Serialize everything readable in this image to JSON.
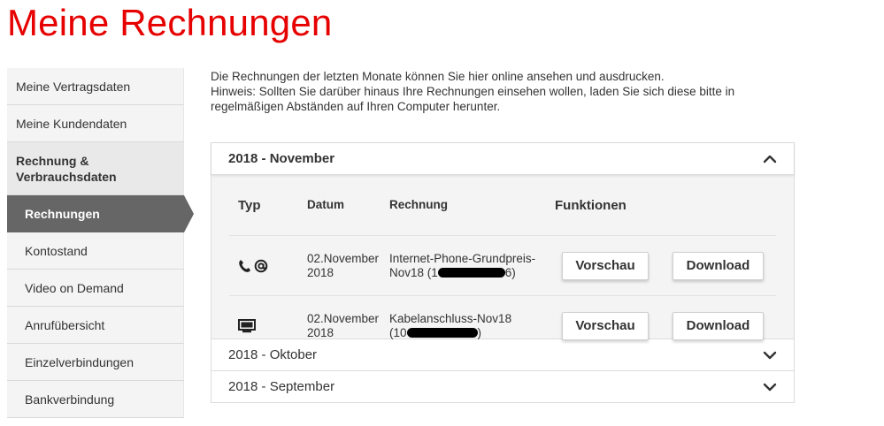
{
  "page": {
    "title": "Meine Rechnungen"
  },
  "sidebar": {
    "items": [
      {
        "label": "Meine Vertragsdaten"
      },
      {
        "label": "Meine Kundendaten"
      },
      {
        "label": "Rechnung & Verbrauchsdaten"
      },
      {
        "label": "Rechnungen"
      },
      {
        "label": "Kontostand"
      },
      {
        "label": "Video on Demand"
      },
      {
        "label": "Anrufübersicht"
      },
      {
        "label": "Einzelverbindungen"
      },
      {
        "label": "Bankverbindung"
      }
    ]
  },
  "intro": {
    "line1": "Die Rechnungen der letzten Monate können Sie hier online ansehen und ausdrucken.",
    "line2": "Hinweis: Sollten Sie darüber hinaus Ihre Rechnungen einsehen wollen, laden Sie sich diese bitte in regelmäßigen Abständen auf Ihren Computer herunter."
  },
  "accordion": {
    "sections": [
      {
        "label": "2018 - November",
        "expanded": true
      },
      {
        "label": "2018 - Oktober",
        "expanded": false
      },
      {
        "label": "2018 - September",
        "expanded": false
      }
    ],
    "columns": {
      "typ": "Typ",
      "datum": "Datum",
      "rechnung": "Rechnung",
      "funktionen": "Funktionen"
    },
    "rows": [
      {
        "type_icons": [
          "phone-icon",
          "at-icon"
        ],
        "date_line1": "02.November",
        "date_line2": "2018",
        "invoice_line1": "Internet-Phone-Grundpreis-",
        "invoice_line2_prefix": "Nov18 (1",
        "invoice_line2_suffix": "6)",
        "preview_label": "Vorschau",
        "download_label": "Download"
      },
      {
        "type_icons": [
          "tv-icon"
        ],
        "date_line1": "02.November",
        "date_line2": "2018",
        "invoice_line1": "Kabelanschluss-Nov18",
        "invoice_line2_prefix": "(10",
        "invoice_line2_suffix": ")",
        "preview_label": "Vorschau",
        "download_label": "Download"
      }
    ]
  },
  "colors": {
    "brand_red": "#e60000",
    "active_nav": "#666666",
    "panel_bg": "#f4f4f4"
  }
}
